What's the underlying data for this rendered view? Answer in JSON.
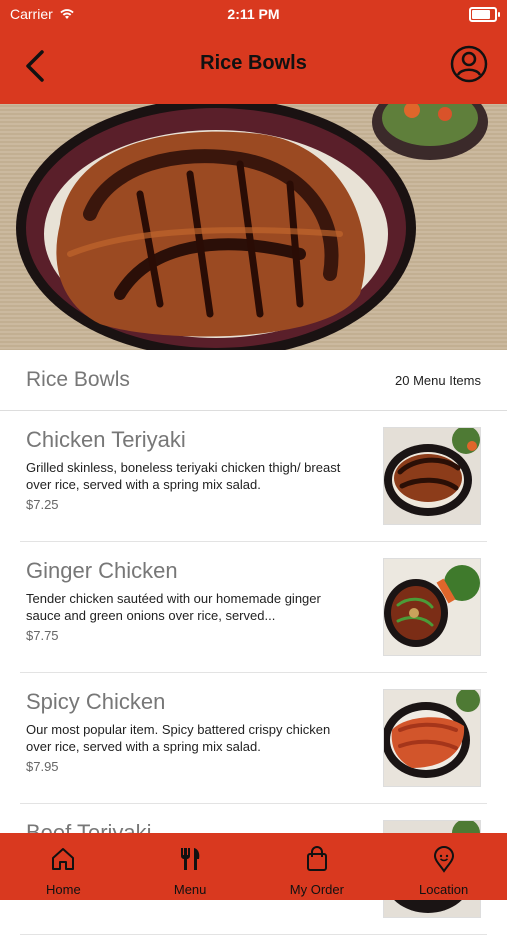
{
  "status": {
    "carrier": "Carrier",
    "time": "2:11 PM",
    "battery_level": 0.9
  },
  "header": {
    "title": "Rice Bowls"
  },
  "section": {
    "name": "Rice Bowls",
    "count": "20 Menu Items"
  },
  "items": [
    {
      "name": "Chicken Teriyaki",
      "desc": "Grilled skinless, boneless teriyaki chicken thigh/ breast over rice, served with a spring mix salad.",
      "price": "$7.25"
    },
    {
      "name": "Ginger Chicken",
      "desc": "Tender chicken sautéed with our homemade ginger sauce and green onions over rice, served...",
      "price": "$7.75"
    },
    {
      "name": "Spicy Chicken",
      "desc": "Our most popular item. Spicy battered crispy chicken over rice, served with a spring mix salad.",
      "price": "$7.95"
    },
    {
      "name": "Beef Teriyaki",
      "desc": "",
      "price": ""
    }
  ],
  "tabs": [
    {
      "label": "Home",
      "icon": "home-icon"
    },
    {
      "label": "Menu",
      "icon": "utensils-icon"
    },
    {
      "label": "My Order",
      "icon": "bag-icon"
    },
    {
      "label": "Location",
      "icon": "map-pin-icon"
    }
  ],
  "colors": {
    "brand": "#d9391f",
    "title": "#111111",
    "muted": "#777777"
  }
}
